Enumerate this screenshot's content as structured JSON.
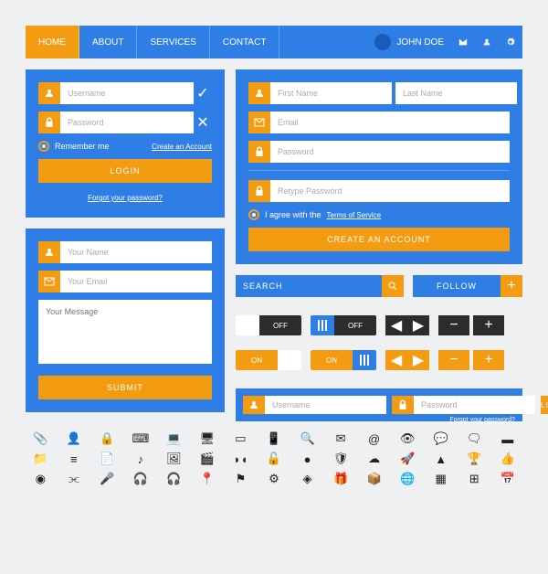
{
  "nav": {
    "items": [
      "HOME",
      "ABOUT",
      "SERVICES",
      "CONTACT"
    ],
    "user": "JOHN DOE"
  },
  "login": {
    "username_ph": "Username",
    "password_ph": "Password",
    "remember": "Remember me",
    "create": "Create an Account",
    "submit": "LOGIN",
    "forgot": "Forgot your password?"
  },
  "contact": {
    "name_ph": "Your Name",
    "email_ph": "Your Email",
    "msg_ph": "Your Message",
    "submit": "SUBMIT"
  },
  "signup": {
    "fname_ph": "First Name",
    "lname_ph": "Last Name",
    "email_ph": "Email",
    "pass_ph": "Password",
    "repass_ph": "Retype Password",
    "agree": "I agree with the",
    "tos": "Terms of Service",
    "submit": "CREATE AN ACCOUNT"
  },
  "search": {
    "ph": "SEARCH"
  },
  "follow": {
    "label": "FOLLOW"
  },
  "toggles": {
    "off": "OFF",
    "on": "ON"
  },
  "inline": {
    "user_ph": "Username",
    "pass_ph": "Password",
    "submit": "LOGIN",
    "forgot": "Forgot your password?"
  },
  "icons": [
    "paperclip",
    "user",
    "lock",
    "keyboard",
    "laptop",
    "monitor",
    "tablet",
    "phone",
    "search",
    "mail",
    "at",
    "eye",
    "chat",
    "comment",
    "wallet",
    "folder",
    "layers",
    "file",
    "music",
    "image",
    "video",
    "mask",
    "lock2",
    "badge",
    "shield",
    "cloud",
    "rocket",
    "map",
    "trophy",
    "thumbs",
    "wifi",
    "share",
    "mic",
    "headset",
    "headphones",
    "marker",
    "flag",
    "gear",
    "cube",
    "gift",
    "box",
    "globe",
    "grid",
    "calc",
    "calendar"
  ]
}
